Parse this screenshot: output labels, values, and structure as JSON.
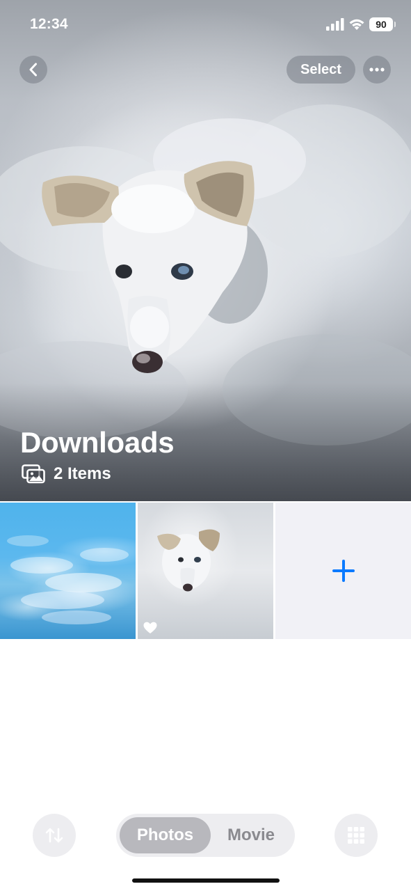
{
  "status_bar": {
    "time": "12:34",
    "battery": "90",
    "icons": [
      "signal-icon",
      "wifi-icon",
      "battery-icon"
    ]
  },
  "header": {
    "back_icon": "chevron-left-icon",
    "select_label": "Select",
    "more_icon": "ellipsis-icon"
  },
  "album": {
    "title": "Downloads",
    "items_icon": "photo-stack-icon",
    "item_count": "2 Items"
  },
  "grid": {
    "tiles": [
      {
        "kind": "photo",
        "subject": "sky"
      },
      {
        "kind": "photo",
        "subject": "dog",
        "favorite_icon": "heart-icon"
      },
      {
        "kind": "add",
        "icon": "plus-icon"
      }
    ],
    "accent_color": "#0a7aff"
  },
  "bottom_bar": {
    "sort_icon": "sort-arrows-icon",
    "segments": [
      "Photos",
      "Movie"
    ],
    "selected_segment": "Photos",
    "grid_icon": "grid-icon"
  }
}
